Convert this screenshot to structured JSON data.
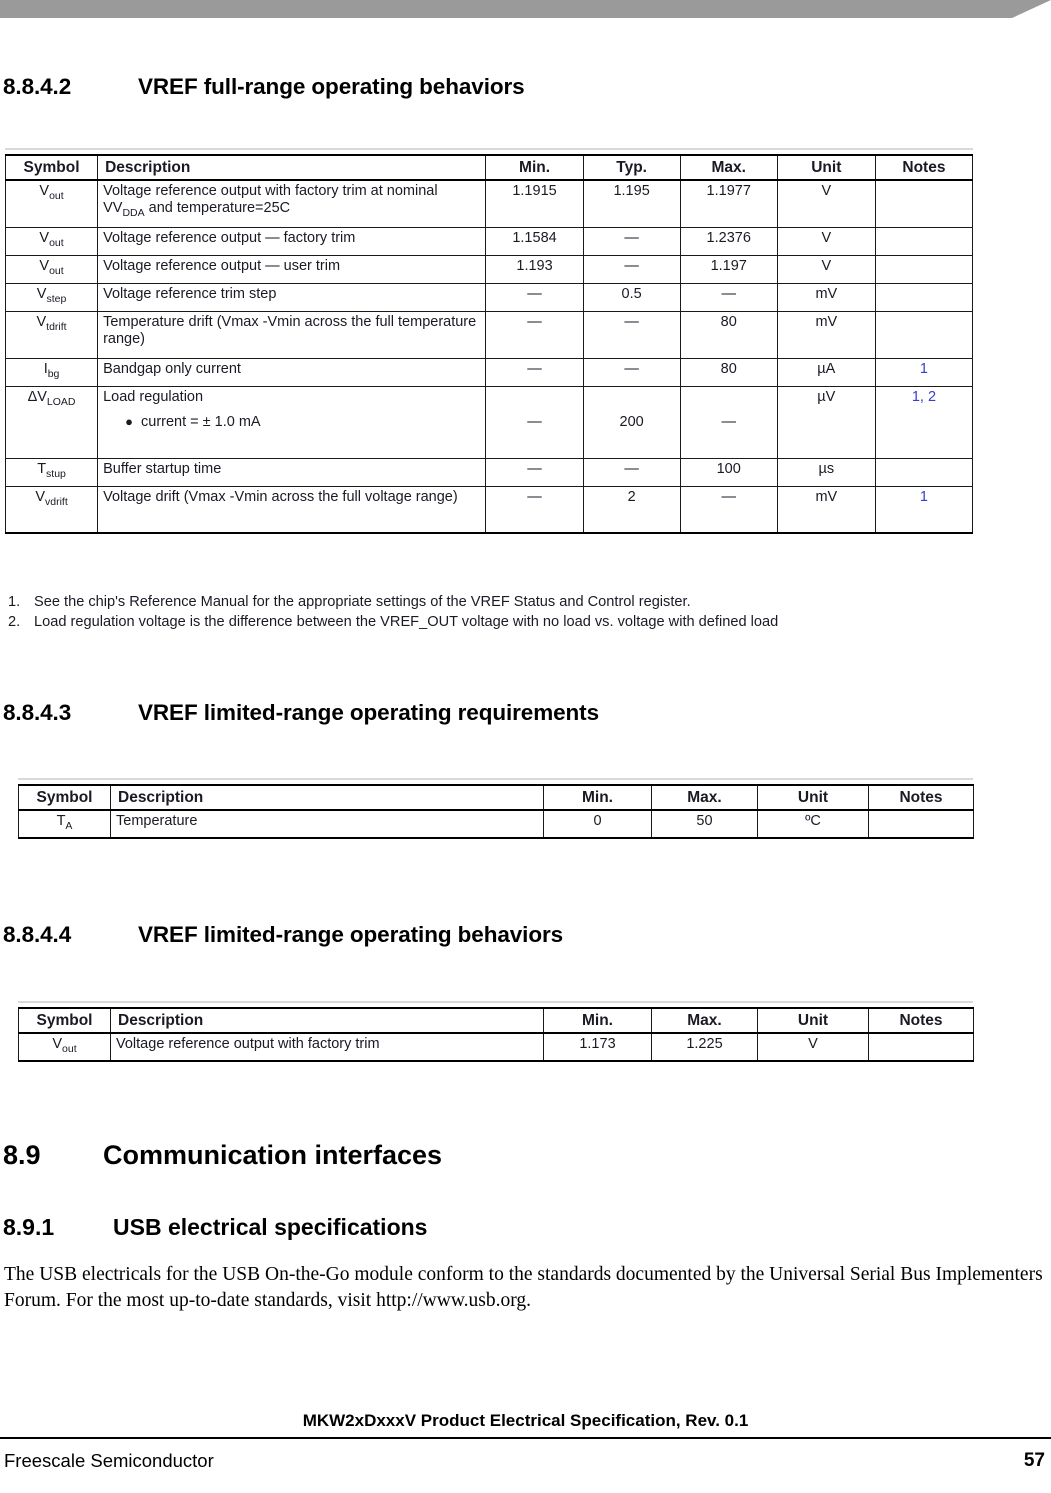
{
  "document": {
    "footer_title": "MKW2xDxxxV Product Electrical Specification, Rev. 0.1",
    "footer_company": "Freescale Semiconductor",
    "page_number": "57"
  },
  "sections": [
    {
      "number": "8.8.4.2",
      "title": "VREF full-range operating behaviors"
    },
    {
      "number": "8.8.4.3",
      "title": "VREF limited-range operating requirements"
    },
    {
      "number": "8.8.4.4",
      "title": "VREF limited-range operating behaviors"
    },
    {
      "number": "8.9",
      "title": "Communication interfaces"
    },
    {
      "number": "8.9.1",
      "title": "USB electrical specifications"
    }
  ],
  "paragraphs": {
    "usb_intro": "The USB electricals for the USB On-the-Go module conform to the standards documented by the Universal Serial Bus Implementers Forum. For the most up-to-date standards, visit http://www.usb.org."
  },
  "table_full_range": {
    "headers": [
      "Symbol",
      "Description",
      "Min.",
      "Typ.",
      "Max.",
      "Unit",
      "Notes"
    ],
    "rows": [
      {
        "symbol": "Vout",
        "symbol_base": "V",
        "symbol_sub": "out",
        "description": "Voltage reference output with factory trim at nominal VDDA and temperature=25C",
        "desc_part1": "Voltage reference output with factory trim at nominal V",
        "desc_sub": "DDA",
        "desc_part2": " and temperature=25C",
        "min": "1.1915",
        "typ": "1.195",
        "max": "1.1977",
        "unit": "V",
        "notes": ""
      },
      {
        "symbol_base": "V",
        "symbol_sub": "out",
        "description": "Voltage reference output — factory trim",
        "min": "1.1584",
        "typ": "—",
        "max": "1.2376",
        "unit": "V",
        "notes": ""
      },
      {
        "symbol_base": "V",
        "symbol_sub": "out",
        "description": "Voltage reference output — user trim",
        "min": "1.193",
        "typ": "—",
        "max": "1.197",
        "unit": "V",
        "notes": ""
      },
      {
        "symbol_base": "V",
        "symbol_sub": "step",
        "description": "Voltage reference trim step",
        "min": "—",
        "typ": "0.5",
        "max": "—",
        "unit": "mV",
        "notes": ""
      },
      {
        "symbol_base": "V",
        "symbol_sub": "tdrift",
        "description": "Temperature drift (Vmax -Vmin across the full temperature range)",
        "min": "—",
        "typ": "—",
        "max": "80",
        "unit": "mV",
        "notes": ""
      },
      {
        "symbol_base": "I",
        "symbol_sub": "bg",
        "description": "Bandgap only current",
        "min": "—",
        "typ": "—",
        "max": "80",
        "unit": "µA",
        "notes": "1"
      },
      {
        "symbol_base": "ΔV",
        "symbol_sub": "LOAD",
        "description": "Load regulation",
        "bullet": "current = ± 1.0 mA",
        "min": "—",
        "typ": "200",
        "max": "—",
        "unit": "µV",
        "notes": "1, 2"
      },
      {
        "symbol_base": "T",
        "symbol_sub": "stup",
        "description": "Buffer startup time",
        "min": "—",
        "typ": "—",
        "max": "100",
        "unit": "µs",
        "notes": ""
      },
      {
        "symbol_base": "V",
        "symbol_sub": "vdrift",
        "description": "Voltage drift (Vmax -Vmin across the full voltage range)",
        "min": "—",
        "typ": "2",
        "max": "—",
        "unit": "mV",
        "notes": "1"
      }
    ],
    "footnotes": [
      {
        "mark": "1.",
        "text": "See the chip's Reference Manual for the appropriate settings of the VREF Status and Control register."
      },
      {
        "mark": "2.",
        "text": "Load regulation voltage is the difference between the VREF_OUT voltage with no load vs. voltage with defined load"
      }
    ]
  },
  "table_limited_requirements": {
    "headers": [
      "Symbol",
      "Description",
      "Min.",
      "Max.",
      "Unit",
      "Notes"
    ],
    "rows": [
      {
        "symbol_base": "T",
        "symbol_sub": "A",
        "description": "Temperature",
        "min": "0",
        "max": "50",
        "unit": "ºC",
        "notes": ""
      }
    ]
  },
  "table_limited_behaviors": {
    "headers": [
      "Symbol",
      "Description",
      "Min.",
      "Max.",
      "Unit",
      "Notes"
    ],
    "rows": [
      {
        "symbol_base": "V",
        "symbol_sub": "out",
        "description": "Voltage reference output with factory trim",
        "min": "1.173",
        "max": "1.225",
        "unit": "V",
        "notes": ""
      }
    ]
  },
  "colors": {
    "banner": "#9a9a9a",
    "notes_accent": "#3a3ad0",
    "rule": "#d9d9d9"
  }
}
